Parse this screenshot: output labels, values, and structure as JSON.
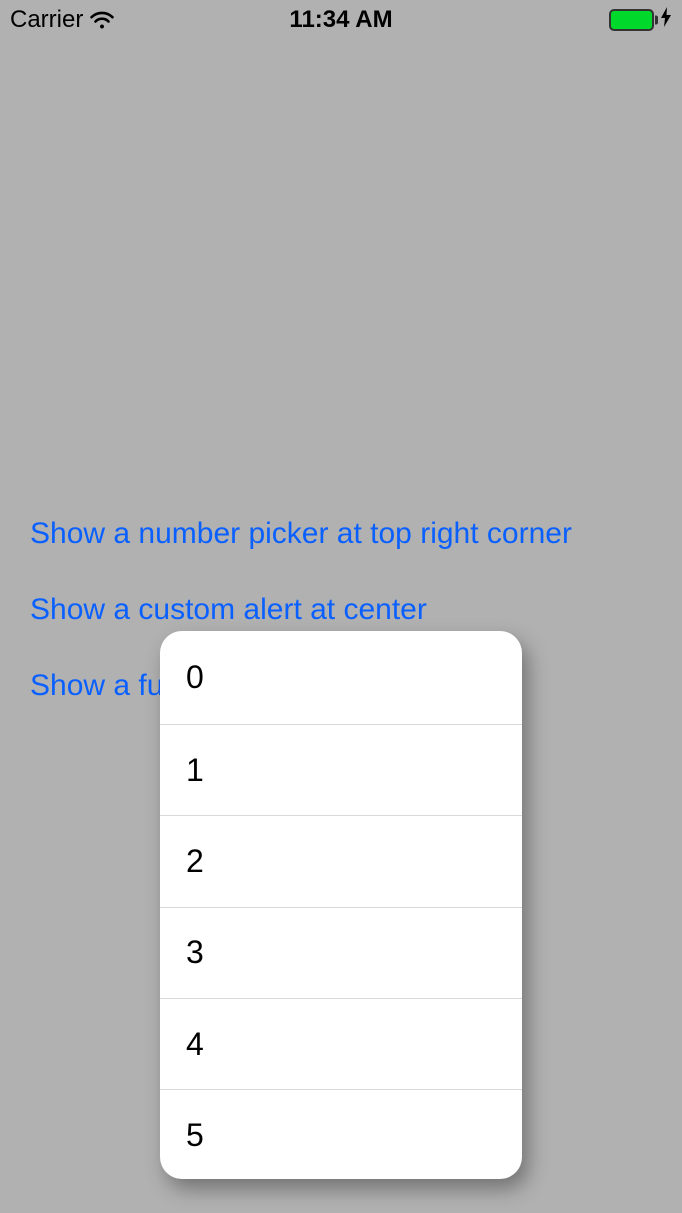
{
  "status_bar": {
    "carrier": "Carrier",
    "time": "11:34 AM"
  },
  "links": {
    "number_picker": "Show a number picker at top right corner",
    "custom_alert": "Show a custom alert at center",
    "full": "Show a ful"
  },
  "picker": {
    "items": [
      "0",
      "1",
      "2",
      "3",
      "4",
      "5"
    ]
  }
}
